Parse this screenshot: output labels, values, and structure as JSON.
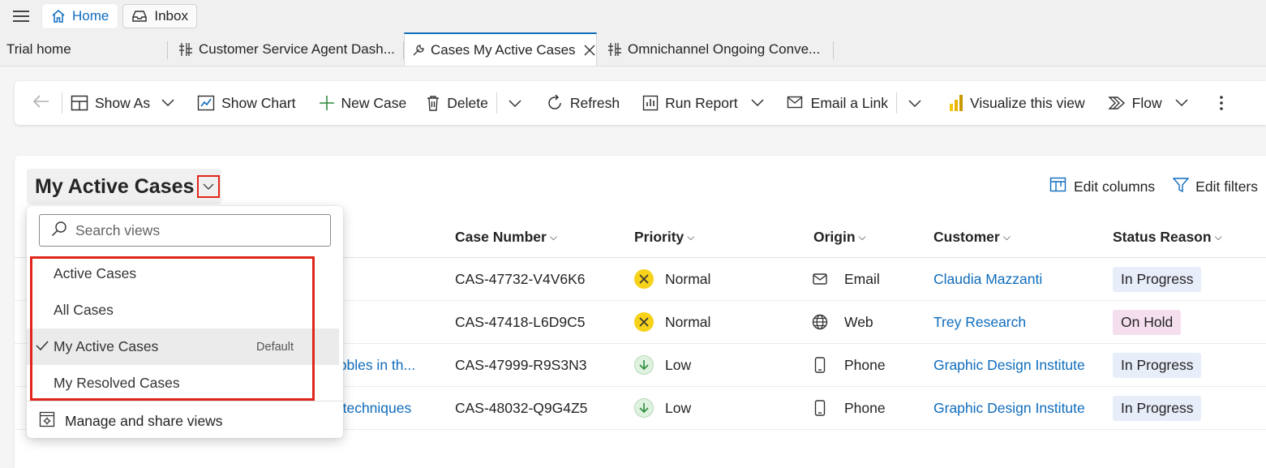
{
  "topbar": {
    "home_label": "Home",
    "inbox_label": "Inbox"
  },
  "tabs": [
    {
      "label": "Trial home"
    },
    {
      "label": "Customer Service Agent Dash..."
    },
    {
      "label": "Cases My Active Cases"
    },
    {
      "label": "Omnichannel Ongoing Conve..."
    }
  ],
  "toolbar": {
    "show_as": "Show As",
    "show_chart": "Show Chart",
    "new_case": "New Case",
    "delete": "Delete",
    "refresh": "Refresh",
    "run_report": "Run Report",
    "email_link": "Email a Link",
    "visualize": "Visualize this view",
    "flow": "Flow"
  },
  "view": {
    "title": "My Active Cases",
    "edit_columns": "Edit columns",
    "edit_filters": "Edit filters"
  },
  "grid": {
    "columns": {
      "case_number": "Case Number",
      "priority": "Priority",
      "origin": "Origin",
      "customer": "Customer",
      "status_reason": "Status Reason"
    },
    "rows": [
      {
        "title": "",
        "case_number": "CAS-47732-V4V6K6",
        "priority": "Normal",
        "origin": "Email",
        "customer": "Claudia Mazzanti",
        "status": "In Progress"
      },
      {
        "title": "",
        "case_number": "CAS-47418-L6D9C5",
        "priority": "Normal",
        "origin": "Web",
        "customer": "Trey Research",
        "status": "On Hold"
      },
      {
        "title": "ubbles in th...",
        "case_number": "CAS-47999-R9S3N3",
        "priority": "Low",
        "origin": "Phone",
        "customer": "Graphic Design Institute",
        "status": "In Progress"
      },
      {
        "title": "g techniques",
        "case_number": "CAS-48032-Q9G4Z5",
        "priority": "Low",
        "origin": "Phone",
        "customer": "Graphic Design Institute",
        "status": "In Progress"
      }
    ]
  },
  "view_selector": {
    "search_placeholder": "Search views",
    "items": [
      {
        "label": "Active Cases"
      },
      {
        "label": "All Cases"
      },
      {
        "label": "My Active Cases",
        "tag": "Default"
      },
      {
        "label": "My Resolved Cases"
      }
    ],
    "manage_label": "Manage and share views"
  },
  "colors": {
    "accent": "#0f6cbd",
    "highlight_border": "#e0261b",
    "priority_normal": "#f7d21a",
    "priority_low": "#dff2e0",
    "status_in_progress": "#e8edfa",
    "status_on_hold": "#f5dfee"
  }
}
